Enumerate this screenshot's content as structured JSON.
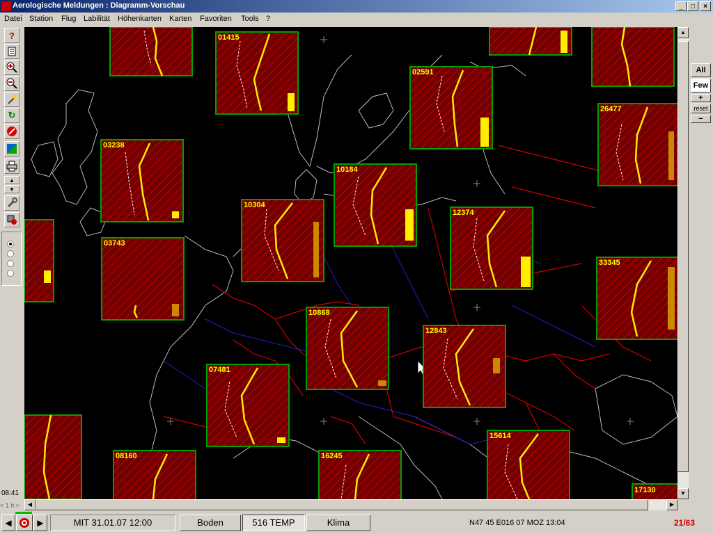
{
  "window": {
    "title": "Aerologische Meldungen : Diagramm-Vorschau"
  },
  "menu": [
    "Datei",
    "Station",
    "Flug",
    "Labilität",
    "Höhenkarten",
    "Karten",
    "Favoriten",
    "Tools",
    "?"
  ],
  "left_toolbar": {
    "icons": [
      "help-icon",
      "document-icon",
      "zoom-in-icon",
      "zoom-out-icon",
      "wand-icon",
      "refresh-icon",
      "stop-icon",
      "chart-icon",
      "print-icon",
      "arrow-up-icon",
      "arrow-down-icon",
      "wrench-icon",
      "settings-icon"
    ],
    "radios": {
      "count": 4,
      "selected": 0
    },
    "time": "08:41",
    "step": "< 1 h >"
  },
  "right_panel": {
    "all": "All",
    "few": "Few",
    "plus": "+",
    "reset": "reset",
    "minus": "−"
  },
  "stations": [
    "01415",
    "02591",
    "26477",
    "03238",
    "10184",
    "10304",
    "12374",
    "03743",
    "33345",
    "10868",
    "12843",
    "07481",
    "15614",
    "08160",
    "16245",
    "17130"
  ],
  "status": {
    "date": "MIT 31.01.07 12:00",
    "boden": "Boden",
    "temp": "516 TEMP",
    "klima": "Klima",
    "coords": "N47 45 E016 07  MOZ 13:04",
    "count": "21/63"
  },
  "colors": {
    "station_label": "#ffff00",
    "diagram_bg": "#7a0000",
    "diagram_border": "#00a000",
    "border_lines": "#d00000",
    "rivers": "#2020d0",
    "coast": "#bbbbbb"
  }
}
